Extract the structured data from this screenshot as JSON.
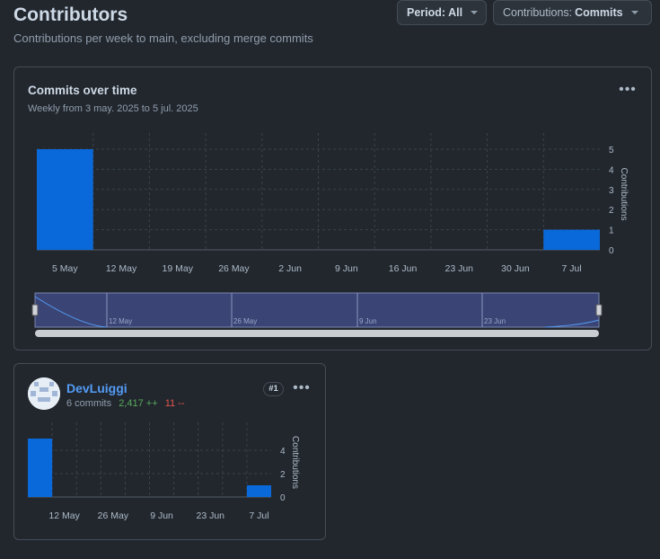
{
  "header": {
    "title": "Contributors",
    "subtitle": "Contributions per week to main, excluding merge commits",
    "period_prefix": "Period: ",
    "period_value": "All",
    "contrib_prefix": "Contributions: ",
    "contrib_value": "Commits"
  },
  "main_card": {
    "title": "Commits over time",
    "subtitle": "Weekly from 3 may. 2025 to 5 jul. 2025",
    "y_axis_label": "Contributions",
    "brush_labels": [
      "12 May",
      "26 May",
      "9 Jun",
      "23 Jun"
    ]
  },
  "user_card": {
    "name": "DevLuiggi",
    "commits": "6 commits",
    "additions": "2,417 ++",
    "deletions": "11 --",
    "rank": "#1",
    "y_axis_label": "Contributions"
  },
  "colors": {
    "bar": "#0969da",
    "accent": "#539bf5",
    "additions": "#57ab5a",
    "deletions": "#e5534b"
  },
  "chart_data": [
    {
      "type": "bar",
      "categories": [
        "5 May",
        "12 May",
        "19 May",
        "26 May",
        "2 Jun",
        "9 Jun",
        "16 Jun",
        "23 Jun",
        "30 Jun",
        "7 Jul"
      ],
      "values": [
        5,
        0,
        0,
        0,
        0,
        0,
        0,
        0,
        0,
        1
      ],
      "title": "Commits over time",
      "ylabel": "Contributions",
      "ylim": [
        0,
        5
      ],
      "yticks": [
        0,
        1,
        2,
        3,
        4,
        5
      ],
      "grid": true
    },
    {
      "type": "bar",
      "categories": [
        "5 May",
        "12 May",
        "19 May",
        "26 May",
        "2 Jun",
        "9 Jun",
        "16 Jun",
        "23 Jun",
        "30 Jun",
        "7 Jul"
      ],
      "tick_labels": [
        "12 May",
        "26 May",
        "9 Jun",
        "23 Jun",
        "7 Jul"
      ],
      "values": [
        5,
        0,
        0,
        0,
        0,
        0,
        0,
        0,
        0,
        1
      ],
      "ylabel": "Contributions",
      "ylim": [
        0,
        5
      ],
      "yticks": [
        0,
        2,
        4
      ],
      "grid": true
    }
  ]
}
